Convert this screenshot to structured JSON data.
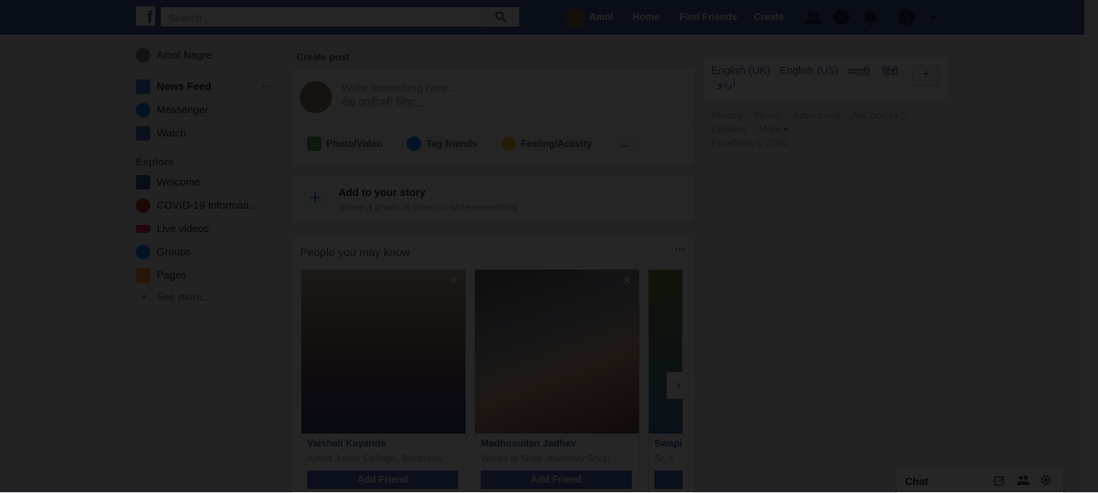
{
  "header": {
    "search_placeholder": "Search",
    "user_name": "Amol",
    "nav_home": "Home",
    "nav_find_friends": "Find Friends",
    "nav_create": "Create",
    "icons": [
      "friend-requests-icon",
      "messenger-icon",
      "notifications-icon",
      "help-icon",
      "account-menu-icon"
    ]
  },
  "sidebar": {
    "profile_name": "Amol Nagre",
    "items": [
      {
        "label": "News Feed",
        "icon": "news-feed-icon"
      },
      {
        "label": "Messenger",
        "icon": "messenger-icon"
      },
      {
        "label": "Watch",
        "icon": "watch-icon"
      }
    ],
    "explore_title": "Explore",
    "explore_items": [
      {
        "label": "Welcome",
        "icon": "welcome-icon"
      },
      {
        "label": "COVID-19 Informati...",
        "icon": "covid-info-icon"
      },
      {
        "label": "Live videos",
        "icon": "live-icon"
      },
      {
        "label": "Groups",
        "icon": "groups-icon"
      },
      {
        "label": "Pages",
        "icon": "pages-icon"
      }
    ],
    "see_more": "See more..."
  },
  "composer": {
    "title": "Create post",
    "placeholder_line1": "Write something here...",
    "placeholder_line2": "येथे काहीतरी लिहा...",
    "photo_video": "Photo/Video",
    "tag_friends": "Tag friends",
    "feeling": "Feeling/Activity",
    "more": "..."
  },
  "story": {
    "title": "Add to your story",
    "subtitle": "Share a photo or video or write something"
  },
  "pymk": {
    "title": "People you may know",
    "add_label": "Add Friend",
    "people": [
      {
        "name": "Vaishali Kayande",
        "sub": "Aided Junior College, Buldhana"
      },
      {
        "name": "Madhusudan Jadhav",
        "sub": "Works at Gold Jewellery Shop"
      },
      {
        "name": "Swapi",
        "sub": "Sr. s"
      }
    ]
  },
  "languages": {
    "items": [
      "English (UK)",
      "English (US)",
      "मराठी",
      "हिंदी",
      "اردو"
    ],
    "add": "+"
  },
  "footer": {
    "links": [
      "Privacy",
      "Terms",
      "Advertising",
      "AdChoices ▷",
      "Cookies",
      "More ▾"
    ],
    "copyright": "Facebook © 2020"
  },
  "chat": {
    "label": "Chat"
  }
}
